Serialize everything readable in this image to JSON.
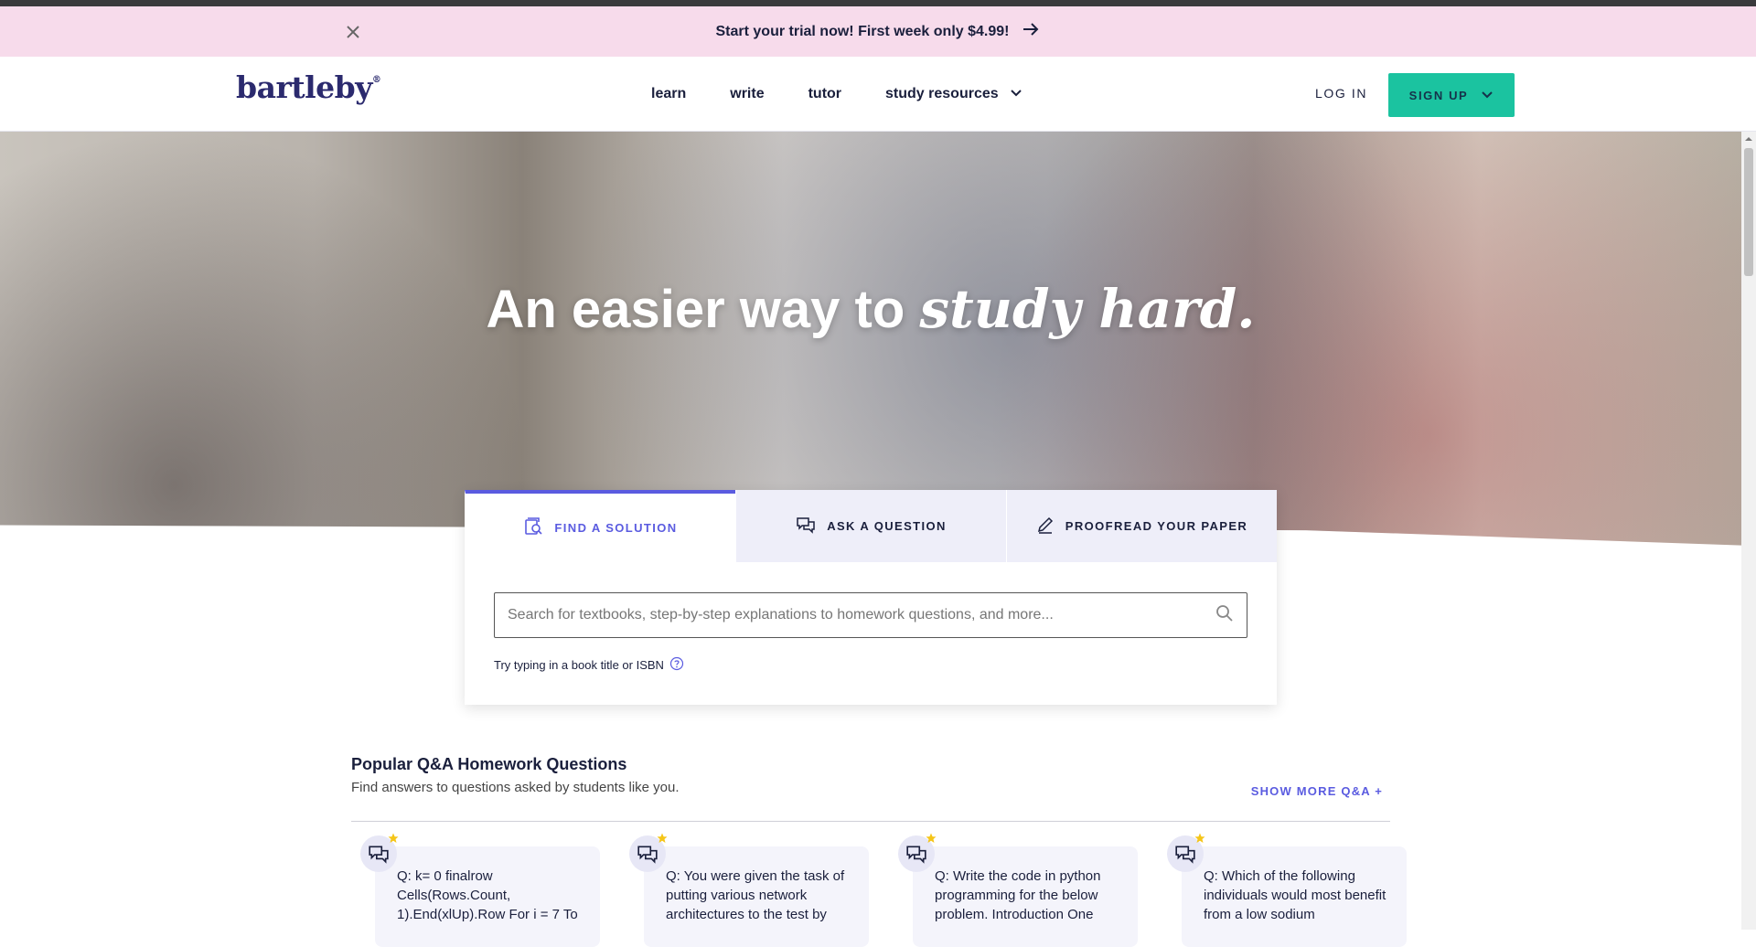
{
  "promo": {
    "text": "Start your trial now! First week only $4.99!"
  },
  "header": {
    "logo": "bartleby",
    "nav": [
      "learn",
      "write",
      "tutor",
      "study resources"
    ],
    "login": "LOG IN",
    "signup": "SIGN UP"
  },
  "hero": {
    "title_plain": "An easier way to ",
    "title_italic": "study hard."
  },
  "search_card": {
    "tabs": [
      "FIND A SOLUTION",
      "ASK A QUESTION",
      "PROOFREAD YOUR PAPER"
    ],
    "active_tab": 0,
    "placeholder": "Search for textbooks, step-by-step explanations to homework questions, and more...",
    "hint": "Try typing in a book title or ISBN"
  },
  "qa": {
    "title": "Popular Q&A Homework Questions",
    "subtitle": "Find answers to questions asked by students like you.",
    "show_more": "SHOW MORE Q&A +",
    "cards": [
      "Q: k= 0 finalrow Cells(Rows.Count, 1).End(xlUp).Row For i = 7 To",
      "Q: You were given the task of putting various network architectures to the test by",
      "Q: Write the code in python programming for the below problem. Introduction One",
      "Q: Which of the following individuals would most benefit from a low sodium"
    ]
  },
  "colors": {
    "accent": "#5a5be0",
    "signup": "#1bc3a0",
    "promo_bg": "#f7dbeb",
    "navy": "#1a1f3c"
  }
}
